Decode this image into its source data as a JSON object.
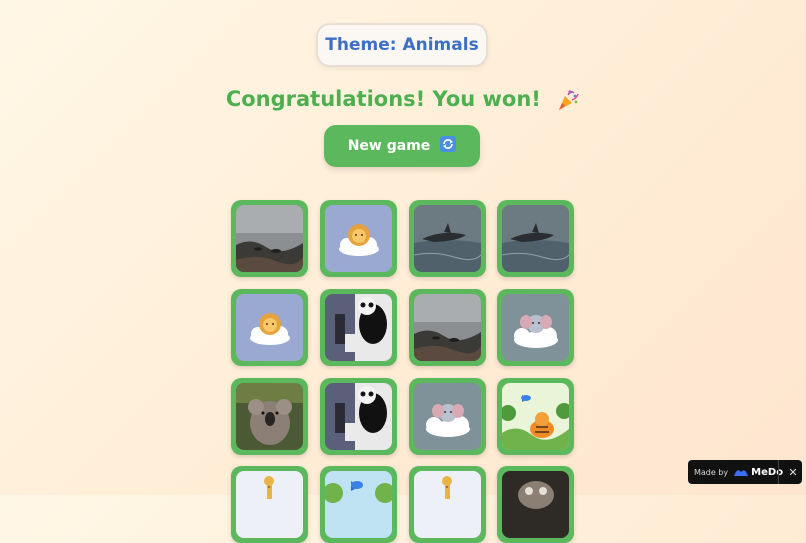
{
  "header": {
    "theme_label": "Theme: Animals"
  },
  "status": {
    "message": "Congratulations! You won!",
    "icon": "party-popper-icon"
  },
  "new_game_button": {
    "label": "New game",
    "icon": "refresh-icon"
  },
  "cards": [
    {
      "image": "seal-rocks-photo"
    },
    {
      "image": "lion-cloud"
    },
    {
      "image": "dolphin-photo"
    },
    {
      "image": "dolphin-photo"
    },
    {
      "image": "lion-cloud"
    },
    {
      "image": "panda-photo"
    },
    {
      "image": "seal-rocks-photo"
    },
    {
      "image": "elephant-cloud"
    },
    {
      "image": "koala-photo"
    },
    {
      "image": "panda-photo"
    },
    {
      "image": "elephant-cloud"
    },
    {
      "image": "tiger-bird"
    },
    {
      "image": "giraffe-cloud"
    },
    {
      "image": "tiger-bird"
    },
    {
      "image": "giraffe-cloud"
    },
    {
      "image": "owl-photo"
    }
  ],
  "badge": {
    "made_by": "Made by",
    "brand": "MeDo",
    "close": "✕"
  }
}
